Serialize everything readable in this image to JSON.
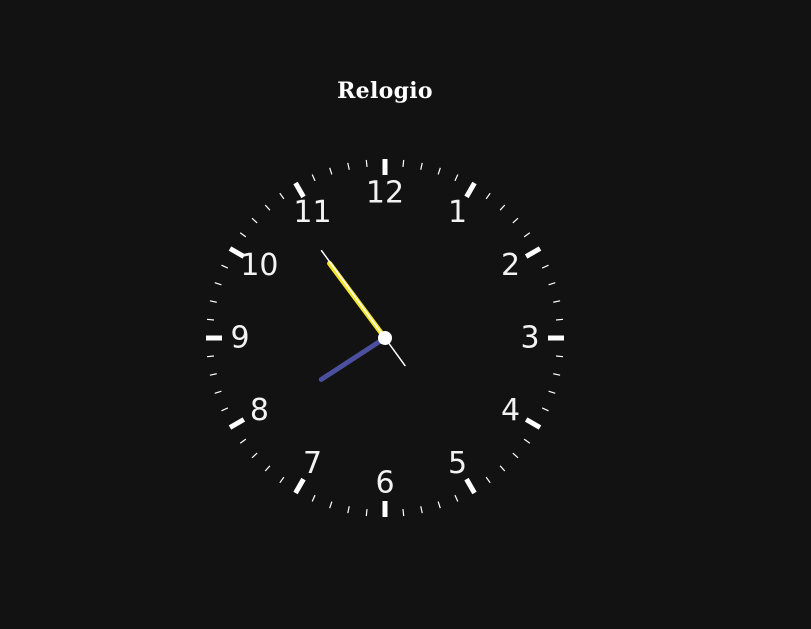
{
  "app": {
    "title": "Relogio"
  },
  "clock": {
    "numbers": [
      "12",
      "1",
      "2",
      "3",
      "4",
      "5",
      "6",
      "7",
      "8",
      "9",
      "10",
      "11"
    ],
    "time": {
      "hours": 7,
      "minutes": 53,
      "seconds": 54
    },
    "colors": {
      "background": "#121212",
      "ticks": "#ffffff",
      "numbers": "#f2f2f2",
      "hour_hand": "#4b4f9e",
      "minute_hand": "#f5e52a",
      "second_hand": "#ffffff",
      "center": "#ffffff"
    }
  }
}
